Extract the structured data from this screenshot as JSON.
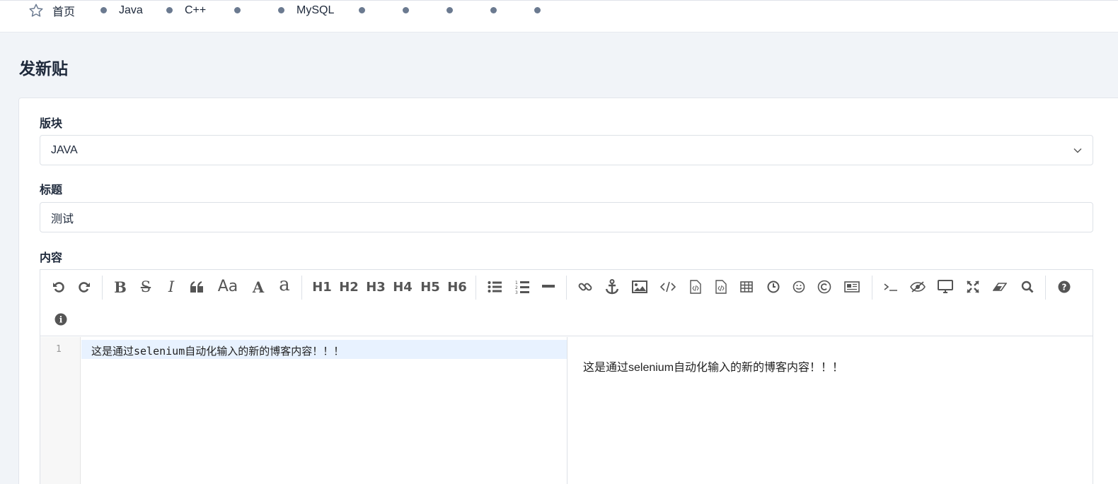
{
  "nav": {
    "home_label": "首页",
    "items": [
      "Java",
      "C++",
      "",
      "MySQL",
      "",
      "",
      "",
      ""
    ]
  },
  "page_title": "发新贴",
  "form": {
    "board_label": "版块",
    "board_value": "JAVA",
    "title_label": "标题",
    "title_value": "测试",
    "content_label": "内容"
  },
  "toolbar": {
    "icons": [
      "undo-icon",
      "redo-icon",
      "bold-icon",
      "strikethrough-icon",
      "italic-icon",
      "quote-icon",
      "uppercase-icon",
      "uppercase-first-icon",
      "lowercase-icon",
      "h1",
      "h2",
      "h3",
      "h4",
      "h5",
      "h6",
      "unordered-list-icon",
      "ordered-list-icon",
      "hr-icon",
      "link-icon",
      "anchor-icon",
      "image-icon",
      "code-icon",
      "preformatted-code-icon",
      "code-block-icon",
      "table-icon",
      "datetime-icon",
      "emoji-icon",
      "html-entities-icon",
      "pagebreak-icon",
      "goto-line-icon",
      "watch-icon",
      "preview-icon",
      "fullscreen-icon",
      "clear-icon",
      "search-icon",
      "help-icon",
      "info-icon"
    ],
    "h1": "H1",
    "h2": "H2",
    "h3": "H3",
    "h4": "H4",
    "h5": "H5",
    "h6": "H6",
    "uppercase": "Aa",
    "uppercase_first": "A",
    "lowercase": "a"
  },
  "editor": {
    "line_number": "1",
    "content": "这是通过selenium自动化输入的新的博客内容！！！",
    "preview": "这是通过selenium自动化输入的新的博客内容！！！"
  },
  "colors": {
    "page_bg": "#f1f4f8",
    "dot": "#6b7a90",
    "active_line": "#e8f2ff"
  }
}
